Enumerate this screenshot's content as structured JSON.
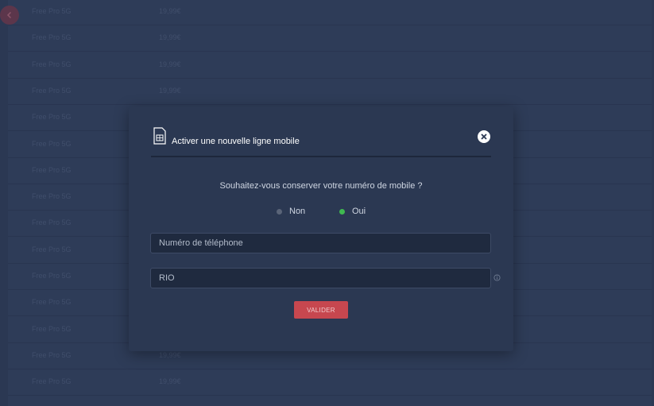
{
  "background_list": {
    "rows": [
      {
        "name": "Free Pro 5G",
        "price": "19,99€"
      },
      {
        "name": "Free Pro 5G",
        "price": "19,99€"
      },
      {
        "name": "Free Pro 5G",
        "price": "19,99€"
      },
      {
        "name": "Free Pro 5G",
        "price": "19,99€"
      },
      {
        "name": "Free Pro 5G",
        "price": ""
      },
      {
        "name": "Free Pro 5G",
        "price": ""
      },
      {
        "name": "Free Pro 5G",
        "price": ""
      },
      {
        "name": "Free Pro 5G",
        "price": ""
      },
      {
        "name": "Free Pro 5G",
        "price": ""
      },
      {
        "name": "Free Pro 5G",
        "price": ""
      },
      {
        "name": "Free Pro 5G",
        "price": ""
      },
      {
        "name": "Free Pro 5G",
        "price": ""
      },
      {
        "name": "Free Pro 5G",
        "price": ""
      },
      {
        "name": "Free Pro 5G",
        "price": "19,99€"
      },
      {
        "name": "Free Pro 5G",
        "price": "19,99€"
      }
    ]
  },
  "modal": {
    "title": "Activer une nouvelle ligne mobile",
    "question": "Souhaitez-vous conserver votre numéro de mobile ?",
    "options": [
      {
        "label": "Non",
        "selected": false
      },
      {
        "label": "Oui",
        "selected": true
      }
    ],
    "phone_placeholder": "Numéro de téléphone",
    "rio_placeholder": "RIO",
    "submit_label": "VALIDER"
  },
  "icons": {
    "back": "chevron-left-icon",
    "sim": "sim-card-icon",
    "close": "close-icon",
    "info": "info-icon"
  },
  "colors": {
    "accent": "#c7474f",
    "selected_radio": "#3fb950",
    "unselected_radio": "#5a6478",
    "modal_bg": "#2b3852"
  }
}
